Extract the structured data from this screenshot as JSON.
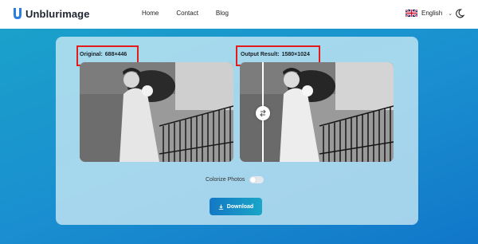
{
  "brand": {
    "name": "Unblurimage"
  },
  "nav": {
    "items": [
      {
        "label": "Home"
      },
      {
        "label": "Contact"
      },
      {
        "label": "Blog"
      }
    ]
  },
  "language": {
    "label": "English",
    "icon": "uk-flag-icon"
  },
  "theme_toggle": {
    "icon": "moon-icon"
  },
  "original": {
    "label": "Original:",
    "dimensions": "688×446"
  },
  "output": {
    "label": "Output Result:",
    "dimensions": "1580×1024"
  },
  "colorize": {
    "label": "Colorize Photos",
    "enabled": false
  },
  "download": {
    "label": "Download",
    "icon": "download-icon"
  },
  "colors": {
    "accent": "#1a8fd0",
    "highlight_box": "#e41b1b"
  }
}
